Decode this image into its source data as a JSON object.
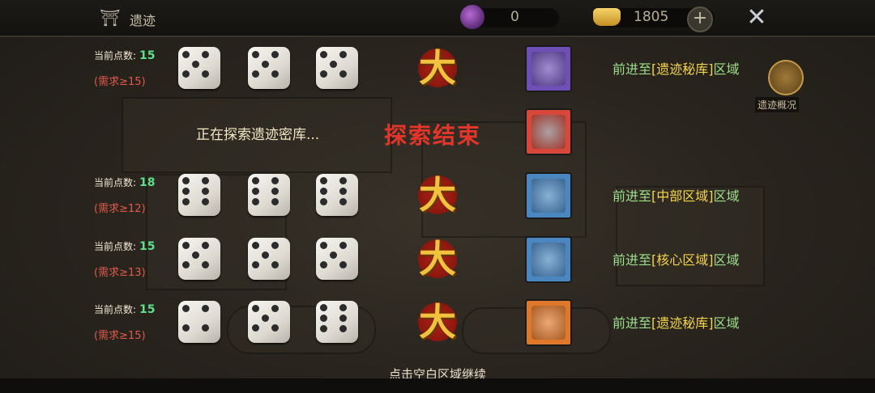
{
  "header": {
    "title": "遗迹",
    "resource1_value": "0",
    "resource2_value": "1805",
    "plus_symbol": "+",
    "close_symbol": "✕"
  },
  "overview": {
    "label": "遗迹概况"
  },
  "rows": [
    {
      "points_label": "当前点数:",
      "points": "15",
      "requirement": "(需求≥15)",
      "dice": [
        5,
        5,
        5
      ],
      "seal": "大",
      "reward_color": "#6e4fb5",
      "advance_prefix": "前进至",
      "destination": "[遗迹秘库]",
      "advance_suffix": "区域"
    },
    {
      "points_label": "当前点数:",
      "points": "18",
      "requirement": "(需求≥12)",
      "dice": [
        6,
        6,
        6
      ],
      "seal": "大",
      "reward_color": "#4a86c0",
      "advance_prefix": "前进至",
      "destination": "[中部区域]",
      "advance_suffix": "区域"
    },
    {
      "points_label": "当前点数:",
      "points": "15",
      "requirement": "(需求≥13)",
      "dice": [
        5,
        5,
        5
      ],
      "seal": "大",
      "reward_color": "#4a86c0",
      "advance_prefix": "前进至",
      "destination": "[核心区域]",
      "advance_suffix": "区域"
    },
    {
      "points_label": "当前点数:",
      "points": "15",
      "requirement": "(需求≥15)",
      "dice": [
        4,
        5,
        6
      ],
      "seal": "大",
      "reward_color": "#e0782c",
      "advance_prefix": "前进至",
      "destination": "[遗迹秘库]",
      "advance_suffix": "区域"
    }
  ],
  "exploring": {
    "text": "正在探索遗迹密库...",
    "end_text": "探索结束",
    "reward_color": "#d8483a"
  },
  "continue_hint": "点击空白区域继续"
}
